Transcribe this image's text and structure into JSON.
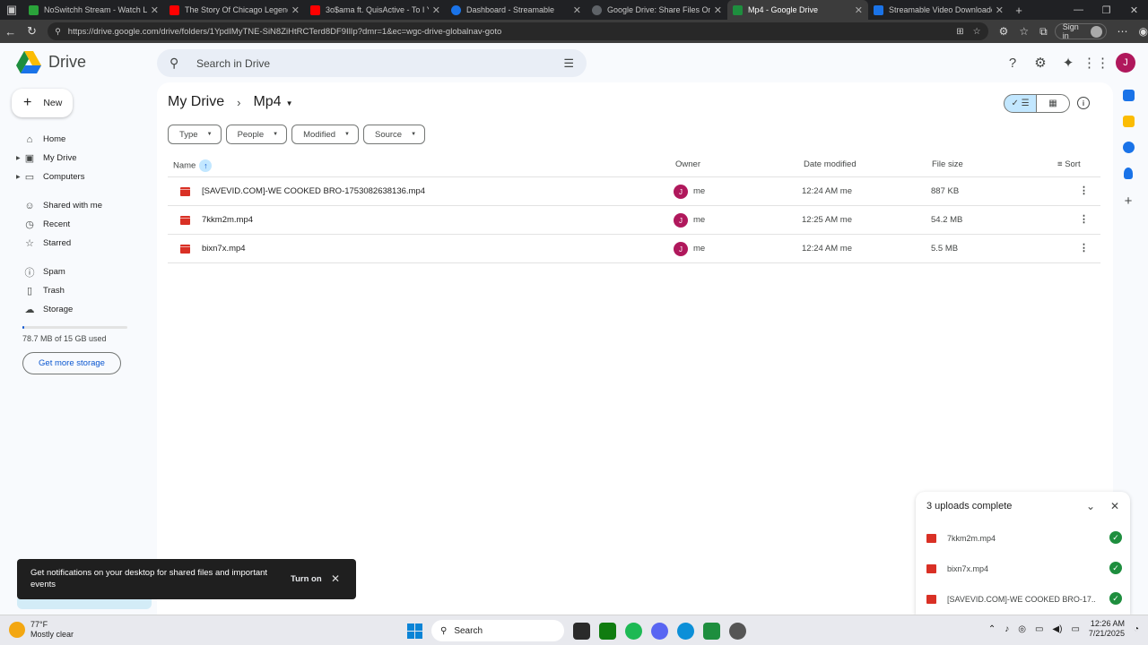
{
  "browser": {
    "tabs": [
      {
        "label": "NoSwitchh Stream - Watch Live o",
        "color": "#2aa33a"
      },
      {
        "label": "The Story Of Chicago Legend Lil",
        "color": "#ff0000"
      },
      {
        "label": "3o$ama ft. QuisActive - To I Yawn",
        "color": "#ff0000"
      },
      {
        "label": "Dashboard - Streamable",
        "color": "#1a73e8"
      },
      {
        "label": "Google Drive: Share Files Online",
        "color": "#5f6368"
      },
      {
        "label": "Mp4 - Google Drive",
        "color": "#1e8e3e"
      },
      {
        "label": "Streamable Video Downloader",
        "color": "#1a73e8"
      }
    ],
    "url": "https://drive.google.com/drive/folders/1YpdIMyTNE-SiN8ZiHtRCTerd8DF9IlIp?dmr=1&ec=wgc-drive-globalnav-goto",
    "signin_label": "Sign in"
  },
  "drive": {
    "logo_text": "Drive",
    "search_placeholder": "Search in Drive",
    "avatar_letter": "J",
    "new_label": "New"
  },
  "sidebar": {
    "items": [
      {
        "label": "Home",
        "icon": "home-icon",
        "glyph": "⌂"
      },
      {
        "label": "My Drive",
        "icon": "drive-icon",
        "glyph": "▣"
      },
      {
        "label": "Computers",
        "icon": "computer-icon",
        "glyph": "▭"
      },
      {
        "label": "Shared with me",
        "icon": "people-icon",
        "glyph": "☺"
      },
      {
        "label": "Recent",
        "icon": "clock-icon",
        "glyph": "◷"
      },
      {
        "label": "Starred",
        "icon": "star-icon",
        "glyph": "☆"
      },
      {
        "label": "Spam",
        "icon": "spam-icon",
        "glyph": "ⓘ"
      },
      {
        "label": "Trash",
        "icon": "trash-icon",
        "glyph": "🗑"
      },
      {
        "label": "Storage",
        "icon": "cloud-icon",
        "glyph": "☁"
      }
    ],
    "storage_text": "78.7 MB of 15 GB used",
    "storage_fraction": 0.005,
    "more_storage_label": "Get more storage"
  },
  "main": {
    "breadcrumb_root": "My Drive",
    "breadcrumb_current": "Mp4",
    "filters": [
      "Type",
      "People",
      "Modified",
      "Source"
    ],
    "columns": {
      "name": "Name",
      "owner": "Owner",
      "date": "Date modified",
      "size": "File size",
      "sort": "Sort"
    },
    "files": [
      {
        "name": "[SAVEVID.COM]-WE COOKED BRO-1753082638136.mp4",
        "owner_letter": "J",
        "owner": "me",
        "date": "12:24 AM me",
        "size": "887 KB"
      },
      {
        "name": "7kkm2m.mp4",
        "owner_letter": "J",
        "owner": "me",
        "date": "12:25 AM me",
        "size": "54.2 MB"
      },
      {
        "name": "bixn7x.mp4",
        "owner_letter": "J",
        "owner": "me",
        "date": "12:24 AM me",
        "size": "5.5 MB"
      }
    ]
  },
  "uploads": {
    "title": "3 uploads complete",
    "items": [
      "7kkm2m.mp4",
      "bixn7x.mp4",
      "[SAVEVID.COM]-WE COOKED BRO-17..."
    ]
  },
  "toast": {
    "message": "Get notifications on your desktop for shared files and important events",
    "action": "Turn on"
  },
  "taskbar": {
    "temperature": "77°F",
    "weather": "Mostly clear",
    "search_label": "Search",
    "time": "12:26 AM",
    "date": "7/21/2025"
  },
  "colors": {
    "accent": "#0b57d0",
    "video_red": "#d93025",
    "avatar": "#b0185c",
    "success": "#1e8e3e"
  }
}
